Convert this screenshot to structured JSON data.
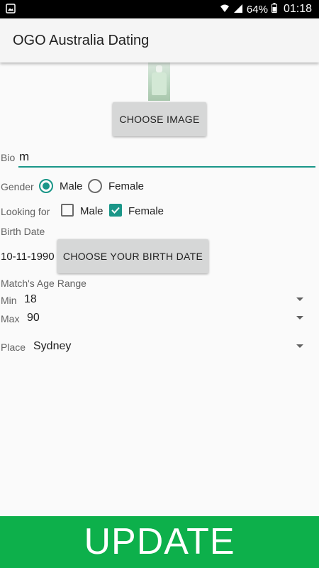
{
  "status_bar": {
    "battery": "64%",
    "time": "01:18"
  },
  "app_bar": {
    "title": "OGO Australia Dating"
  },
  "profile": {
    "choose_image_label": "CHOOSE IMAGE"
  },
  "bio": {
    "label": "Bio",
    "value": "m"
  },
  "gender": {
    "label": "Gender",
    "options": [
      {
        "label": "Male",
        "selected": true
      },
      {
        "label": "Female",
        "selected": false
      }
    ]
  },
  "looking_for": {
    "label": "Looking for",
    "options": [
      {
        "label": "Male",
        "checked": false
      },
      {
        "label": "Female",
        "checked": true
      }
    ]
  },
  "birth_date": {
    "label": "Birth Date",
    "value": "10-11-1990",
    "button_label": "CHOOSE YOUR BIRTH DATE"
  },
  "age_range": {
    "label": "Match's Age Range",
    "min_label": "Min",
    "min_value": "18",
    "max_label": "Max",
    "max_value": "90"
  },
  "place": {
    "label": "Place",
    "value": "Sydney"
  },
  "update_button": {
    "label": "UPDATE"
  },
  "colors": {
    "accent": "#1a9688",
    "update_bg": "#0db04b",
    "button_bg": "#d6d7d7",
    "app_bar_bg": "#f5f5f5"
  }
}
